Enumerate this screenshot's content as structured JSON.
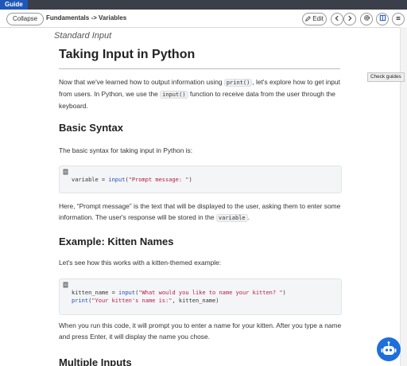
{
  "tab": {
    "label": "Guide"
  },
  "toolbar": {
    "collapse_label": "Collapse",
    "breadcrumb": "Fundamentals -> Variables",
    "edit_label": "Edit"
  },
  "side": {
    "check_guides": "Check guides"
  },
  "doc": {
    "section_label": "Standard Input",
    "title": "Taking Input in Python",
    "intro_1": "Now that we've learned how to output information using ",
    "intro_code_1": "print()",
    "intro_2": ", let's explore how to get input from users. In Python, we use the ",
    "intro_code_2": "input()",
    "intro_3": " function to receive data from the user through the keyboard.",
    "h_basic": "Basic Syntax",
    "basic_text": "The basic syntax for taking input in Python is:",
    "code1_var": "variable = ",
    "code1_fn": "input",
    "code1_open": "(",
    "code1_str": "\"Prompt message: \"",
    "code1_close": ")",
    "explain_1": "Here, “Prompt message” is the text that will be displayed to the user, asking them to enter some information. The user's response will be stored in the ",
    "explain_code": "variable",
    "explain_2": ".",
    "h_example": "Example: Kitten Names",
    "example_text": "Let's see how this works with a kitten-themed example:",
    "code2_l1_var": "kitten_name = ",
    "code2_l1_fn": "input",
    "code2_l1_str": "\"What would you like to name your kitten? \"",
    "code2_l2_fn": "print",
    "code2_l2_str": "\"Your kitten's name is:\"",
    "code2_l2_rest": ", kitten_name)",
    "run_text": "When you run this code, it will prompt you to enter a name for your kitten. After you type a name and press Enter, it will display the name you chose.",
    "h_multiple": "Multiple Inputs"
  },
  "colors": {
    "accent": "#1f57b8",
    "bot": "#1e6fd9",
    "string": "#b5204a",
    "function": "#1b4fbf"
  },
  "icons": [
    "pencil-icon",
    "chevron-left-icon",
    "chevron-right-icon",
    "gear-icon",
    "book-icon",
    "menu-icon",
    "copy-icon",
    "robot-icon"
  ]
}
